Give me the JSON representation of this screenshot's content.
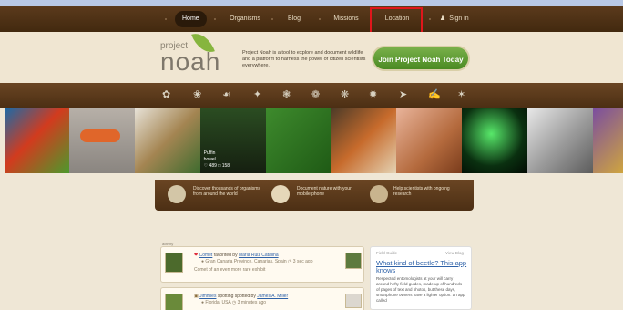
{
  "nav": {
    "items": [
      "Home",
      "Organisms",
      "Blog",
      "Missions",
      "Location",
      "Sign in"
    ],
    "active": "Home"
  },
  "header": {
    "logo_small": "project",
    "logo_big": "noah",
    "tagline": "Project Noah is a tool to explore and document wildlife and a platform to harness the power of citizen scientists everywhere.",
    "join_label": "Join Project Noah Today"
  },
  "categories": [
    "leaf-icon",
    "flower-icon",
    "mushroom-icon",
    "bird-icon",
    "insect-icon",
    "shell-icon",
    "butterfly-icon",
    "frog-icon",
    "fish-icon",
    "hand-icon",
    "starfish-icon"
  ],
  "photo_caption": {
    "name": "Puffin",
    "sub": "bowel",
    "likes": "489",
    "comments": "158"
  },
  "info": [
    "Discover thousands of organisms from around the world",
    "Document nature with your mobile phone",
    "Help scientists with ongoing research"
  ],
  "feed": {
    "label": "activity",
    "item1": {
      "link": "Comet",
      "action": "favorited by",
      "user": "Maria Ruiz Catalina",
      "location": "Gran Canaria Province, Canarias, Spain",
      "time": "3 sec ago",
      "comment": "Comet of an even more rare exhibit"
    },
    "item2": {
      "title": "Jimmies",
      "action": "spotting spotted by",
      "user": "James A. Miller",
      "location": "Florida, USA",
      "time": "3 minutes ago"
    }
  },
  "sidebar": {
    "heading": "Field Guide",
    "view": "View Blog",
    "title": "What kind of beetle? This app knows",
    "body": "Respected entomologists at your will carry around hefty field guides, made up of hundreds of pages of text and photos, but these days, smartphone owners have a lighter option: an app called"
  }
}
